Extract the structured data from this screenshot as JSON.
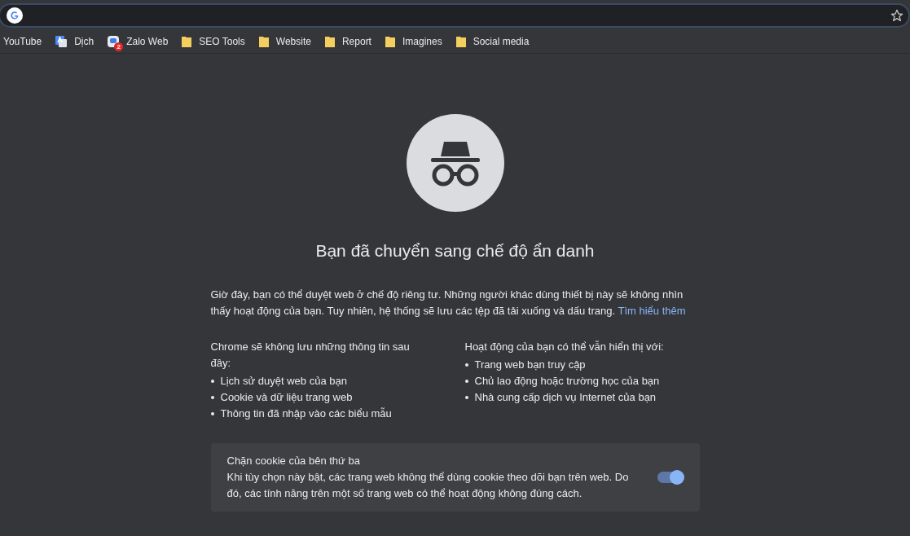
{
  "bookmarks": [
    {
      "kind": "plain",
      "label": "YouTube"
    },
    {
      "kind": "translate",
      "label": "Dịch"
    },
    {
      "kind": "app",
      "label": "Zalo Web",
      "badge": "2"
    },
    {
      "kind": "folder",
      "label": "SEO Tools"
    },
    {
      "kind": "folder",
      "label": "Website"
    },
    {
      "kind": "folder",
      "label": "Report"
    },
    {
      "kind": "folder",
      "label": "Imagines"
    },
    {
      "kind": "folder",
      "label": "Social media"
    }
  ],
  "heading": "Bạn đã chuyển sang chế độ ẩn danh",
  "intro": {
    "text": "Giờ đây, bạn có thể duyệt web ở chế độ riêng tư. Những người khác dùng thiết bị này sẽ không nhìn thấy hoạt động của bạn. Tuy nhiên, hệ thống sẽ lưu các tệp đã tải xuống và dấu trang.",
    "link": "Tìm hiểu thêm"
  },
  "columns": [
    {
      "title": "Chrome sẽ không lưu những thông tin sau đây:",
      "items": [
        "Lịch sử duyệt web của bạn",
        "Cookie và dữ liệu trang web",
        "Thông tin đã nhập vào các biểu mẫu"
      ]
    },
    {
      "title": "Hoạt động của bạn có thể vẫn hiển thị với:",
      "items": [
        "Trang web bạn truy cập",
        "Chủ lao động hoặc trường học của bạn",
        "Nhà cung cấp dịch vụ Internet của bạn"
      ]
    }
  ],
  "cookie_card": {
    "title": "Chặn cookie của bên thứ ba",
    "description": "Khi tùy chọn này bật, các trang web không thể dùng cookie theo dõi bạn trên web. Do đó, các tính năng trên một số trang web có thể hoạt động không đúng cách.",
    "on": true
  }
}
